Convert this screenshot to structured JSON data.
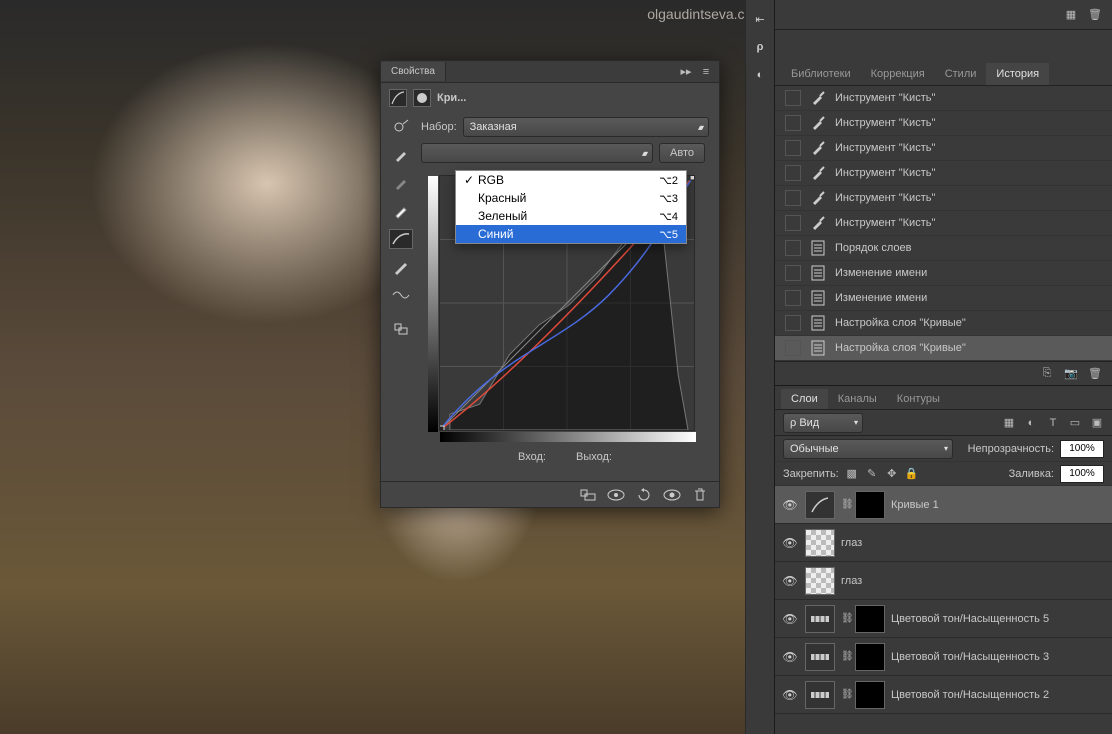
{
  "watermark": "olgaudintseva.com",
  "props": {
    "panel_title": "Свойства",
    "type_label": "Кри...",
    "preset_label": "Набор:",
    "preset_value": "Заказная",
    "auto_button": "Авто",
    "input_label": "Вход:",
    "output_label": "Выход:",
    "channel_menu": [
      {
        "label": "RGB",
        "shortcut": "⌥2",
        "checked": true,
        "selected": false
      },
      {
        "label": "Красный",
        "shortcut": "⌥3",
        "checked": false,
        "selected": false
      },
      {
        "label": "Зеленый",
        "shortcut": "⌥4",
        "checked": false,
        "selected": false
      },
      {
        "label": "Синий",
        "shortcut": "⌥5",
        "checked": false,
        "selected": true
      }
    ]
  },
  "history": {
    "tabs": [
      "Библиотеки",
      "Коррекция",
      "Стили",
      "История"
    ],
    "active_tab": 3,
    "items": [
      {
        "icon": "brush",
        "label": "Инструмент \"Кисть\""
      },
      {
        "icon": "brush",
        "label": "Инструмент \"Кисть\""
      },
      {
        "icon": "brush",
        "label": "Инструмент \"Кисть\""
      },
      {
        "icon": "brush",
        "label": "Инструмент \"Кисть\""
      },
      {
        "icon": "brush",
        "label": "Инструмент \"Кисть\""
      },
      {
        "icon": "brush",
        "label": "Инструмент \"Кисть\""
      },
      {
        "icon": "doc",
        "label": "Порядок слоев"
      },
      {
        "icon": "doc",
        "label": "Изменение имени"
      },
      {
        "icon": "doc",
        "label": "Изменение имени"
      },
      {
        "icon": "doc",
        "label": "Настройка слоя \"Кривые\""
      },
      {
        "icon": "doc",
        "label": "Настройка слоя \"Кривые\"",
        "selected": true
      }
    ]
  },
  "layers": {
    "tabs": [
      "Слои",
      "Каналы",
      "Контуры"
    ],
    "active_tab": 0,
    "filter_label": "ρ Вид",
    "blend_mode": "Обычные",
    "opacity_label": "Непрозрачность:",
    "opacity_value": "100%",
    "lock_label": "Закрепить:",
    "fill_label": "Заливка:",
    "fill_value": "100%",
    "items": [
      {
        "type": "adjust",
        "name": "Кривые 1",
        "selected": true,
        "icon": "curves"
      },
      {
        "type": "pixel",
        "name": "глаз"
      },
      {
        "type": "pixel",
        "name": "глаз"
      },
      {
        "type": "adjust",
        "name": "Цветовой тон/Насыщенность 5",
        "icon": "hsl"
      },
      {
        "type": "adjust",
        "name": "Цветовой тон/Насыщенность 3",
        "icon": "hsl"
      },
      {
        "type": "adjust",
        "name": "Цветовой тон/Насыщенность 2",
        "icon": "hsl"
      }
    ]
  }
}
